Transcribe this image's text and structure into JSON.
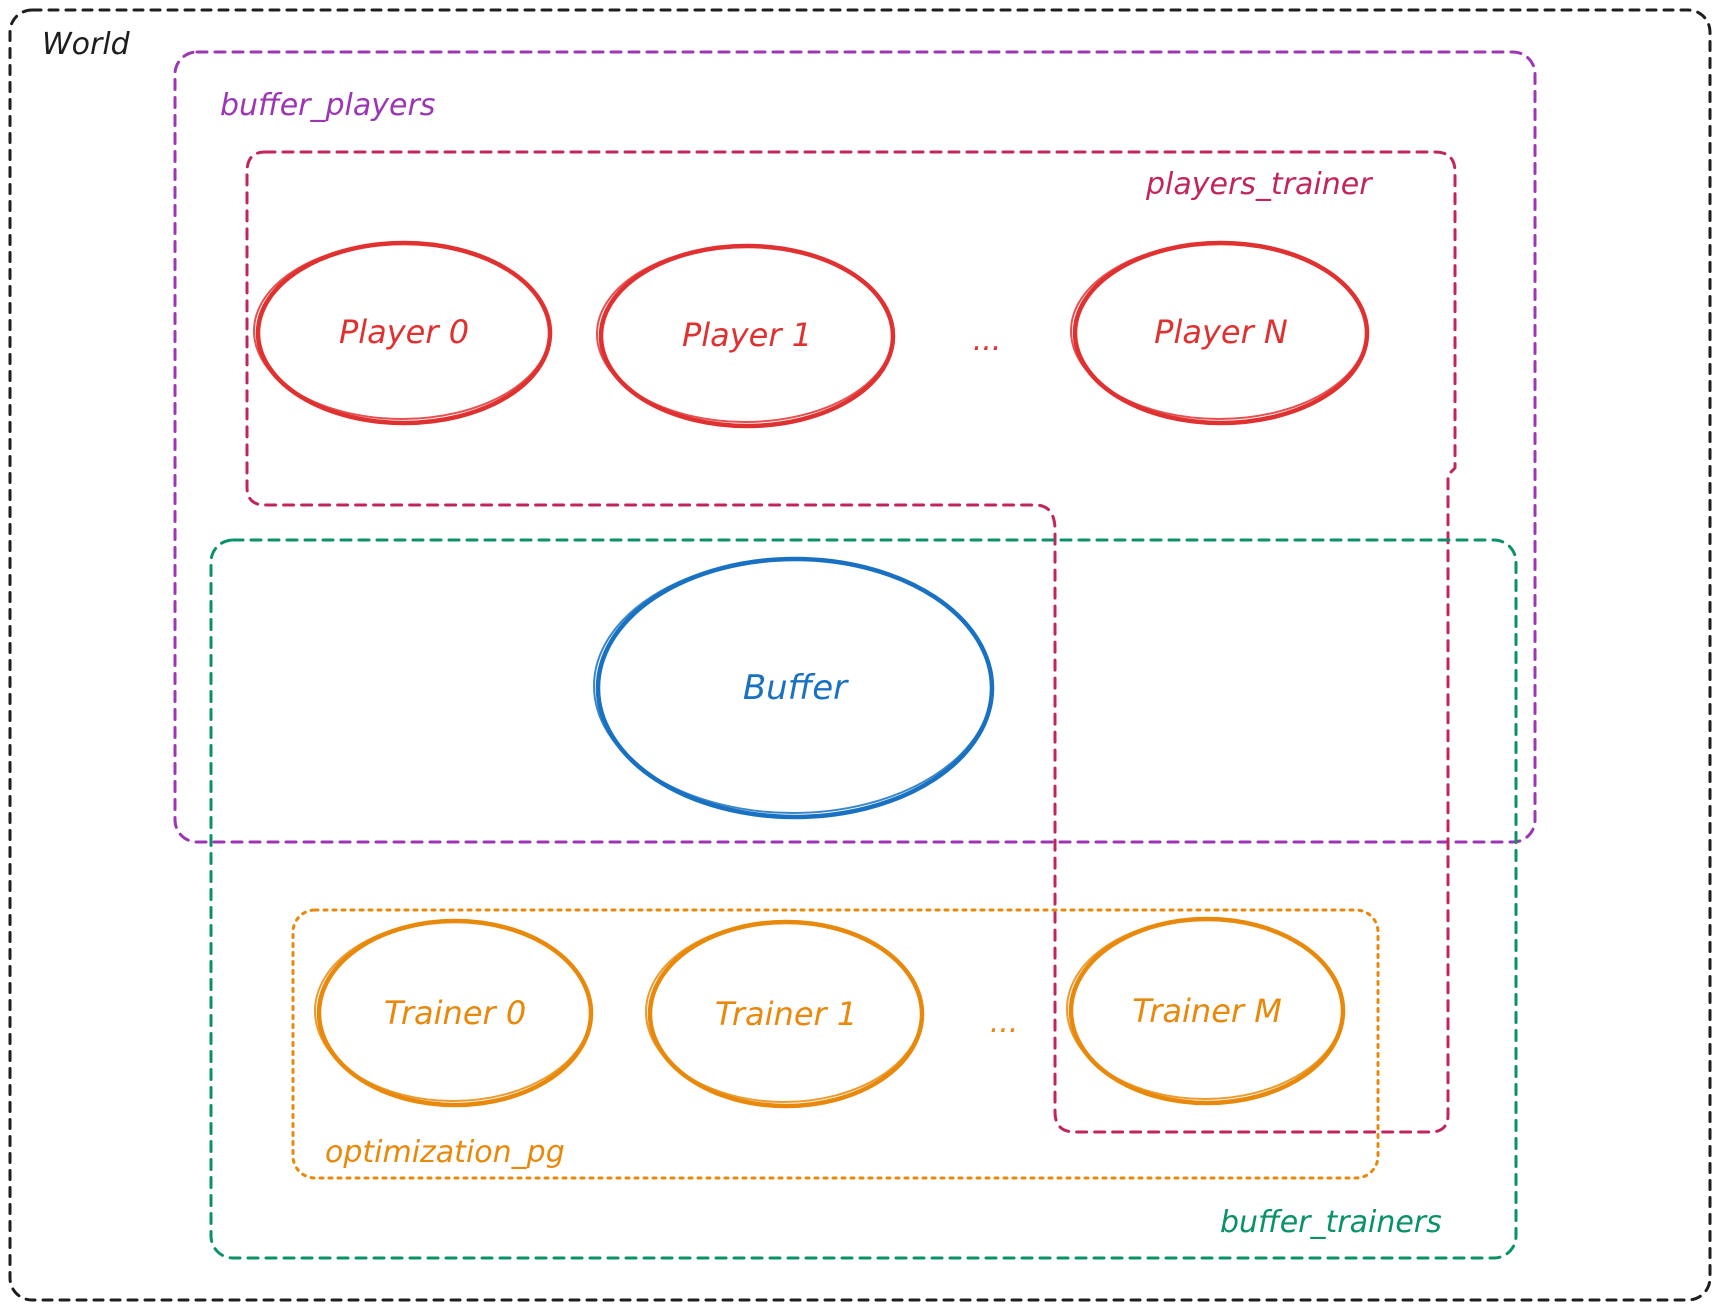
{
  "colors": {
    "world": "#1e1e1e",
    "buffer_players": "#9c36b5",
    "players_trainer": "#c2255c",
    "buffer_trainers": "#099268",
    "optimization_pg": "#e8890c",
    "players": "#e03131",
    "buffer": "#1971c2",
    "trainers": "#e8890c"
  },
  "labels": {
    "world": "World",
    "buffer_players": "buffer_players",
    "players_trainer": "players_trainer",
    "buffer_trainers": "buffer_trainers",
    "optimization_pg": "optimization_pg"
  },
  "players": {
    "player_0": "Player 0",
    "player_1": "Player 1",
    "ellipsis": "...",
    "player_n": "Player N"
  },
  "buffer": {
    "label": "Buffer"
  },
  "trainers": {
    "trainer_0": "Trainer 0",
    "trainer_1": "Trainer 1",
    "ellipsis": "...",
    "trainer_m": "Trainer M"
  }
}
